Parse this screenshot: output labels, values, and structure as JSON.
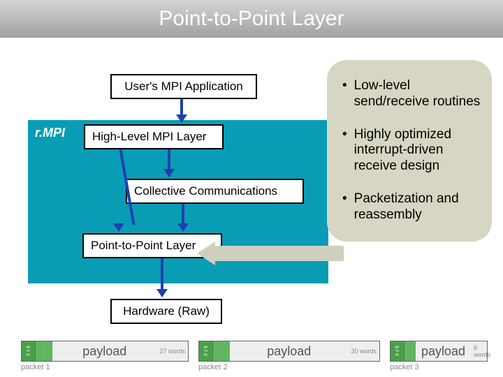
{
  "title": "Point-to-Point Layer",
  "stack": {
    "rmpi_label": "r.MPI",
    "user": "User's MPI Application",
    "high": "High-Level MPI Layer",
    "collective": "Collective Communications",
    "ptp": "Point-to-Point Layer",
    "hw": "Hardware (Raw)"
  },
  "bullets": {
    "b1": "Low-level send/receive routines",
    "b2": "Highly optimized interrupt-driven receive design",
    "b3": "Packetization and reassembly"
  },
  "packets": {
    "src_label": "s r c",
    "payload": "payload",
    "p1_words": "27 words",
    "p2_words": "30 words",
    "p3_words": "6 words",
    "p1_label": "packet 1",
    "p2_label": "packet 2",
    "p3_label": "packet 3"
  }
}
